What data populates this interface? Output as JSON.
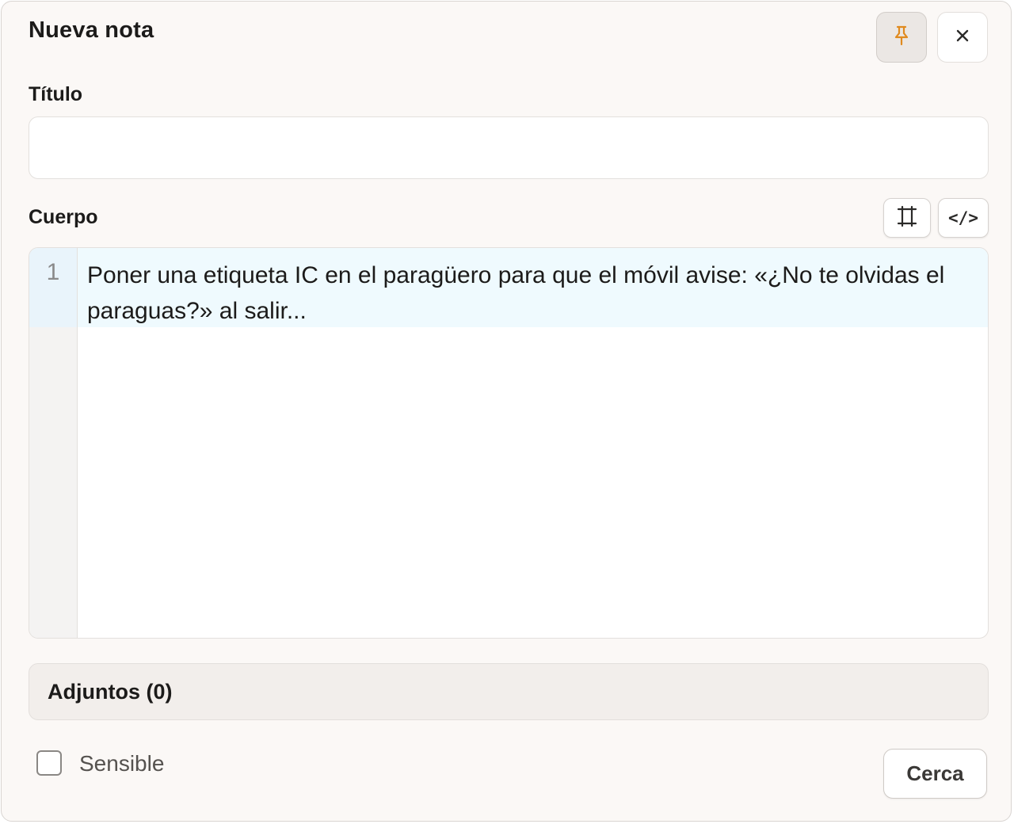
{
  "dialog": {
    "title": "Nueva nota",
    "pin_icon": "pin-icon",
    "close_icon": "close-icon",
    "accent_color": "#e08a1e"
  },
  "form": {
    "title_label": "Título",
    "title_value": "",
    "body_label": "Cuerpo",
    "toolbar": {
      "fullscreen_icon": "fullscreen-icon",
      "code_toggle_label": "</>"
    },
    "editor": {
      "lines": [
        {
          "number": "1",
          "text": "Poner una etiqueta IC en el paragüero para que el móvil avise: «¿No te olvidas el paraguas?» al salir..."
        }
      ]
    },
    "attachments_label": "Adjuntos (0)",
    "sensitive_label": "Sensible",
    "sensitive_checked": false,
    "close_button_label": "Cerca"
  }
}
